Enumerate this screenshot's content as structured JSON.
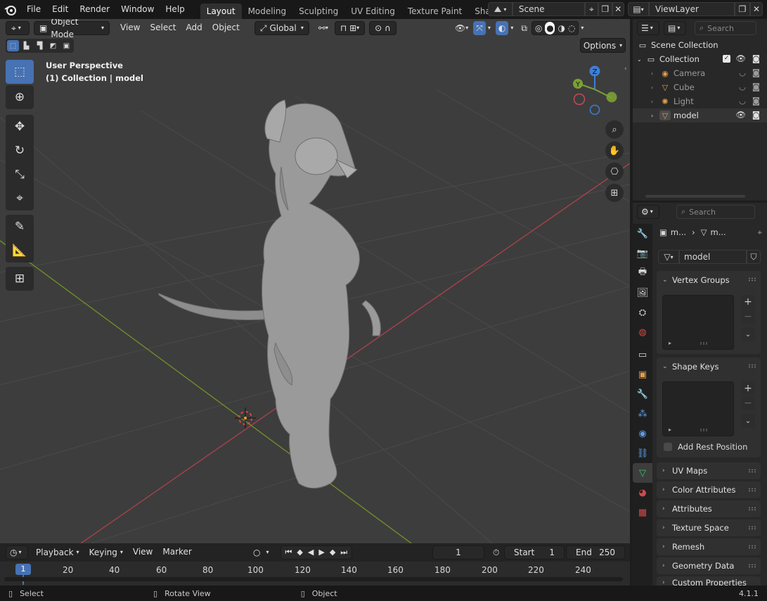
{
  "topbar": {
    "menus": [
      "File",
      "Edit",
      "Render",
      "Window",
      "Help"
    ],
    "workspaces": [
      "Layout",
      "Modeling",
      "Sculpting",
      "UV Editing",
      "Texture Paint",
      "Shading"
    ],
    "active_workspace": "Layout",
    "scene_name": "Scene",
    "view_layer": "ViewLayer"
  },
  "viewport": {
    "mode": "Object Mode",
    "menus": [
      "View",
      "Select",
      "Add",
      "Object"
    ],
    "orientation": "Global",
    "options_label": "Options",
    "overlay_title": "User Perspective",
    "overlay_subtitle": "(1) Collection | model",
    "gizmo": {
      "x": "X",
      "y": "Y",
      "z": "Z"
    }
  },
  "timeline": {
    "menus": [
      "Playback",
      "Keying",
      "View",
      "Marker"
    ],
    "current_frame": "1",
    "start_label": "Start",
    "start_value": "1",
    "end_label": "End",
    "end_value": "250",
    "ruler_ticks": [
      "1",
      "20",
      "40",
      "60",
      "80",
      "100",
      "120",
      "140",
      "160",
      "180",
      "200",
      "220",
      "240"
    ]
  },
  "statusbar": {
    "select": "Select",
    "rotate": "Rotate View",
    "object": "Object",
    "version": "4.1.1"
  },
  "outliner": {
    "search_placeholder": "Search",
    "root": "Scene Collection",
    "collection": "Collection",
    "items": [
      {
        "name": "Camera",
        "icon": "camera-icon",
        "dim": true
      },
      {
        "name": "Cube",
        "icon": "mesh-icon",
        "dim": true
      },
      {
        "name": "Light",
        "icon": "light-icon",
        "dim": true
      },
      {
        "name": "model",
        "icon": "mesh-icon",
        "dim": false
      }
    ]
  },
  "properties": {
    "search_placeholder": "Search",
    "breadcrumb_object": "m...",
    "breadcrumb_data": "m...",
    "mesh_name": "model",
    "panels_open": [
      "Vertex Groups",
      "Shape Keys"
    ],
    "add_rest_position": "Add Rest Position",
    "panels_closed": [
      "UV Maps",
      "Color Attributes",
      "Attributes",
      "Texture Space",
      "Remesh",
      "Geometry Data",
      "Custom Properties"
    ]
  },
  "colors": {
    "accent": "#4772b3",
    "x_axis": "#c64a55",
    "y_axis": "#7aa133",
    "z_axis": "#3f7fd5",
    "viewport_bg": "#3d3d3d"
  }
}
